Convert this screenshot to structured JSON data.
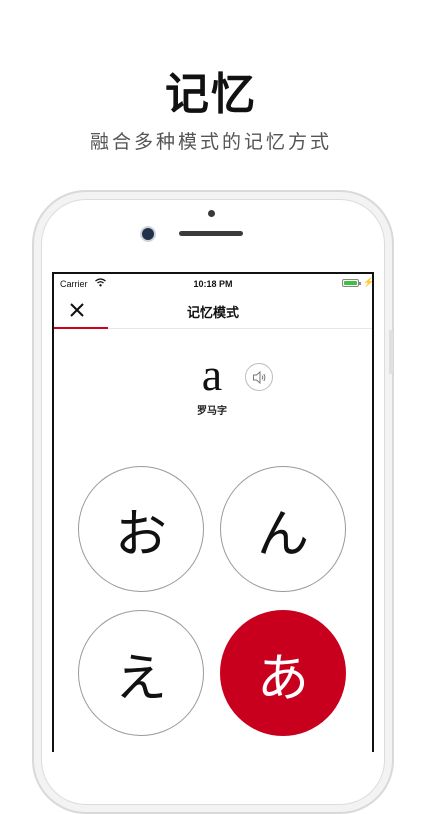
{
  "promo": {
    "title": "记忆",
    "subtitle": "融合多种模式的记忆方式"
  },
  "status_bar": {
    "carrier": "Carrier",
    "time": "10:18 PM"
  },
  "nav": {
    "title": "记忆模式",
    "close_icon": "close-icon"
  },
  "progress": {
    "fraction": 0.17,
    "color": "#d0021b"
  },
  "question": {
    "romaji": "a",
    "label": "罗马字",
    "sound_icon": "speaker-icon"
  },
  "options": [
    {
      "kana": "お",
      "selected": false
    },
    {
      "kana": "ん",
      "selected": false
    },
    {
      "kana": "え",
      "selected": false
    },
    {
      "kana": "あ",
      "selected": true
    }
  ],
  "colors": {
    "accent": "#c8001e",
    "battery": "#3fc03f"
  }
}
